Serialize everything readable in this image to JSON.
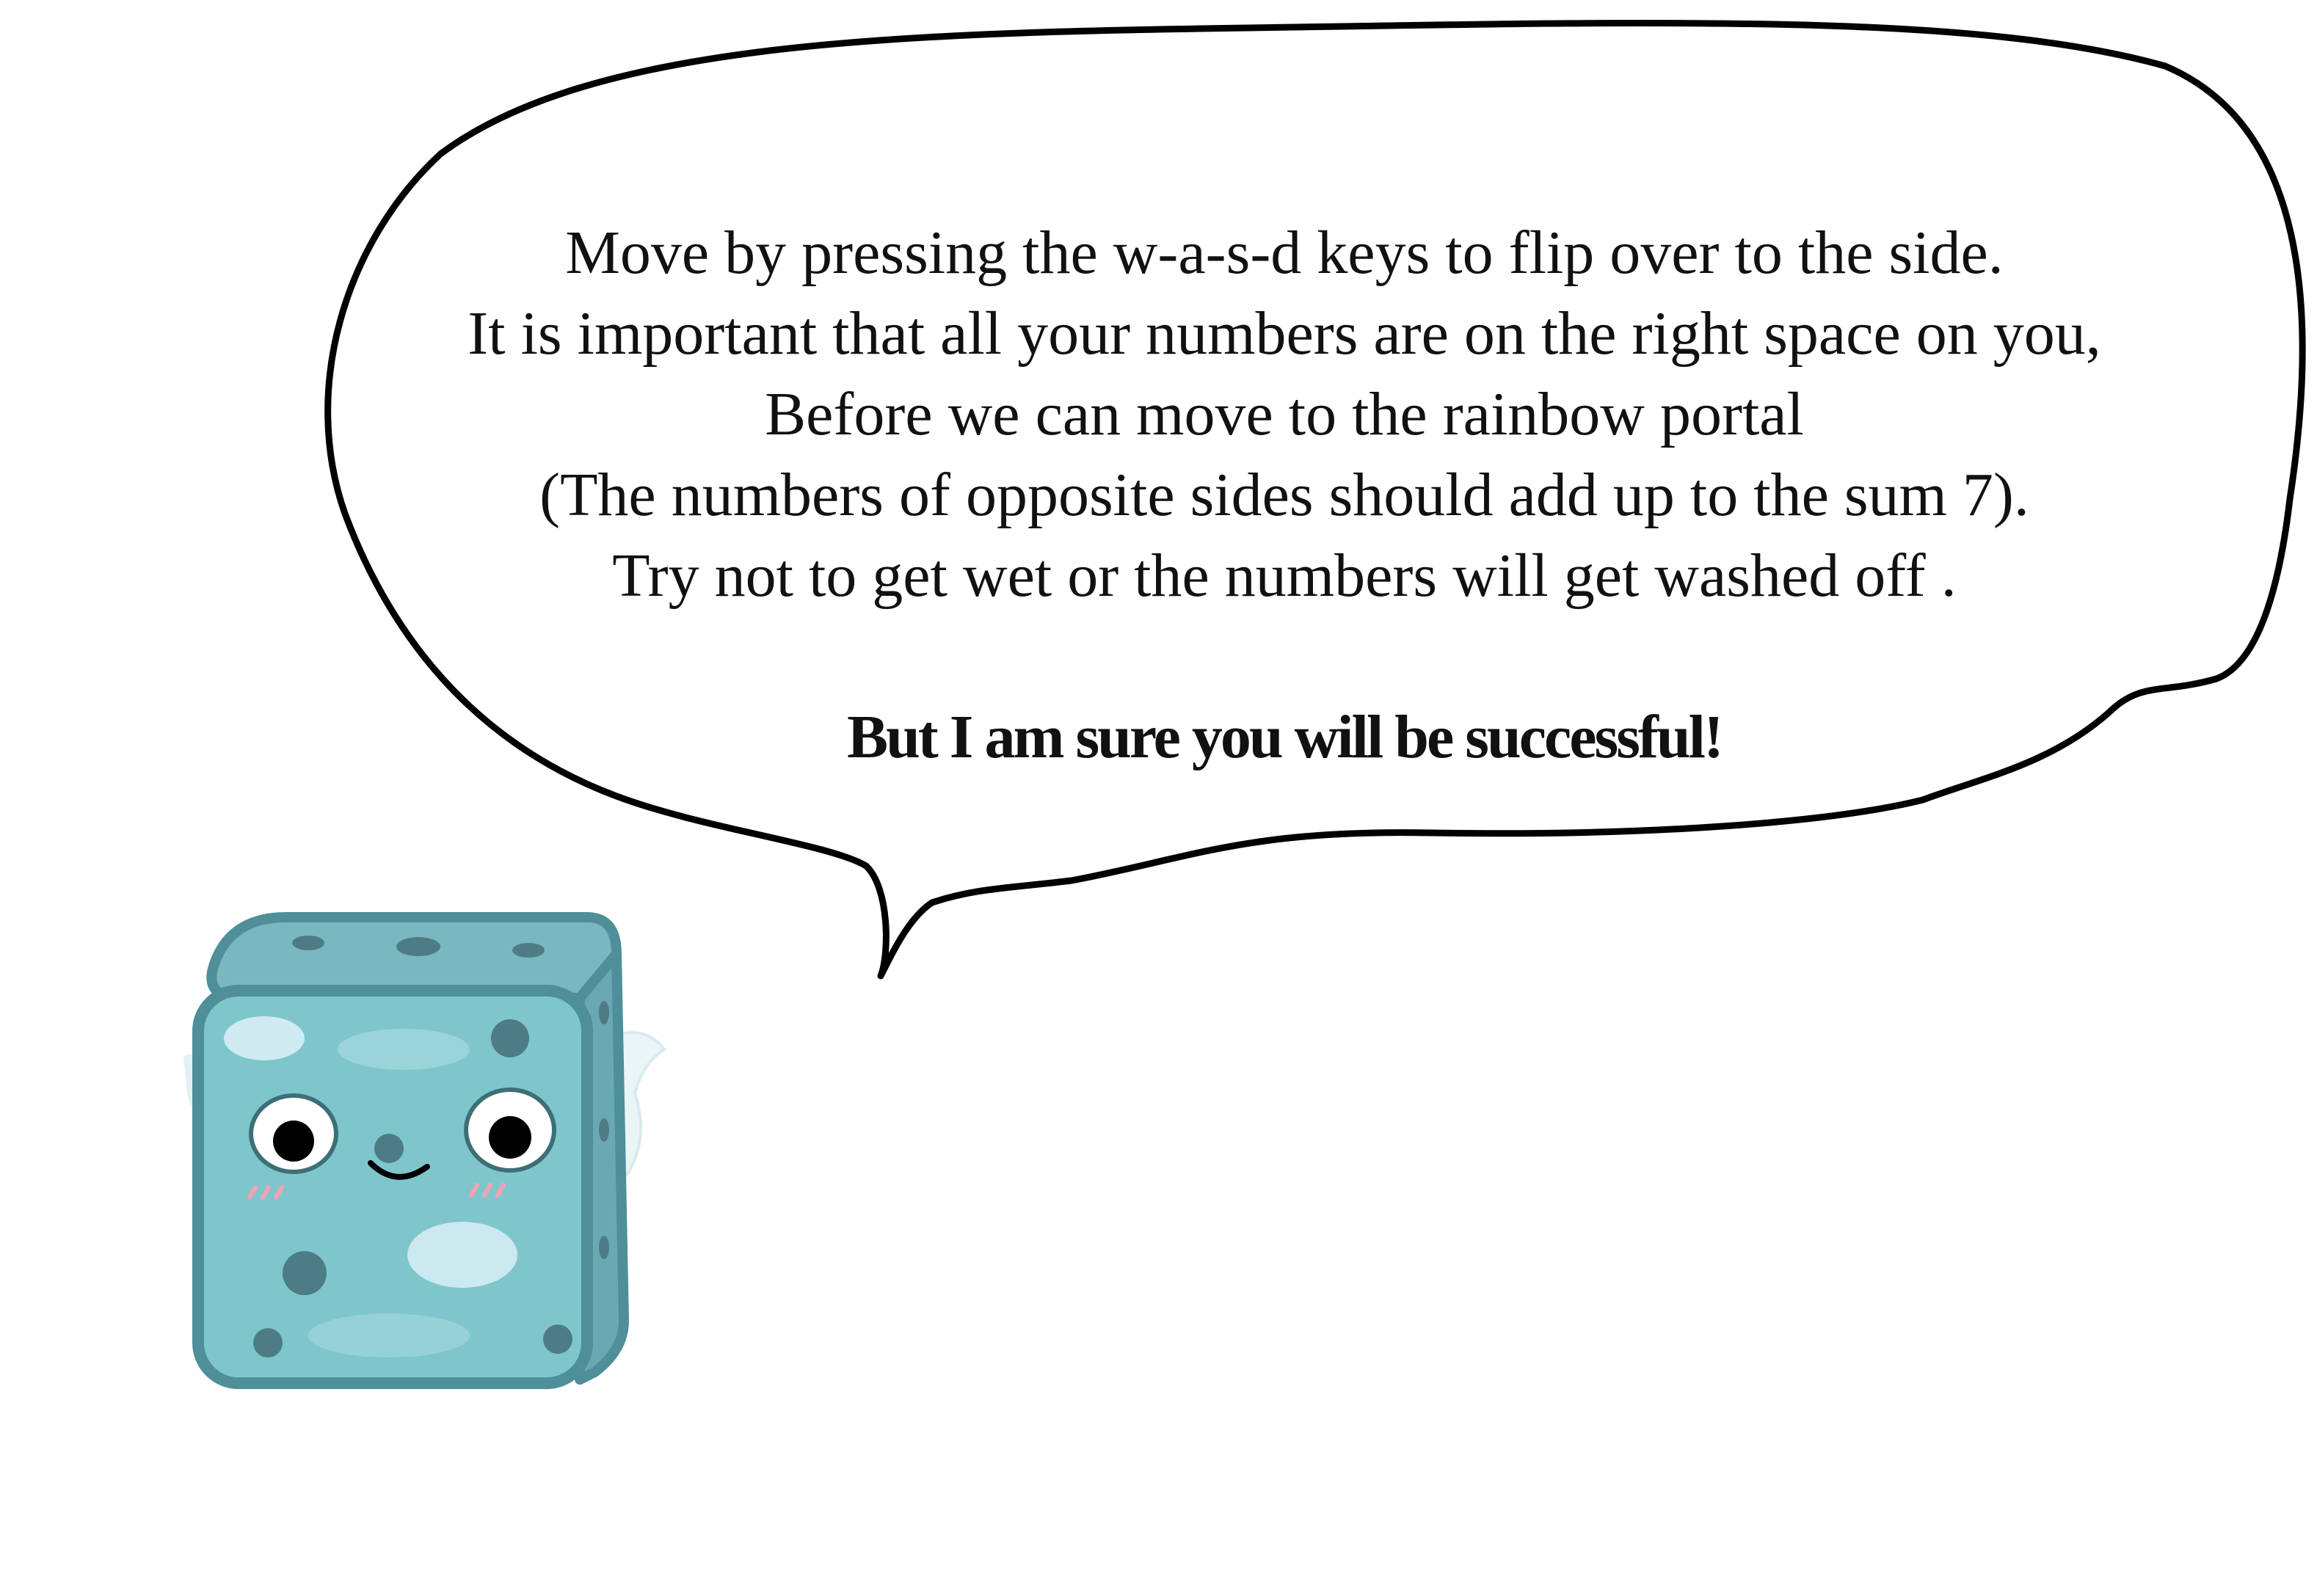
{
  "dialog": {
    "lines": [
      "Move by pressing the w-a-s-d keys to flip over to the side.",
      "It is important that all your numbers are on the right space on you,",
      "Before we can move to the rainbow portal",
      "(The numbers of opposite sides should add up to the sum 7).",
      "Try not to get wet or the numbers will get washed off ."
    ],
    "emphasis": "But I am sure you will be successful!"
  },
  "character": {
    "icon": "smiling-dice-character",
    "body_color": "#7ec6cc",
    "outline_color": "#4e8f9a",
    "highlight_color": "#d8eef5",
    "pip_color": "#4d7c84",
    "blush_color": "#f2a3b3"
  },
  "colors": {
    "bubble_outline": "#000000",
    "bubble_fill": "#ffffff",
    "text": "#111111"
  }
}
